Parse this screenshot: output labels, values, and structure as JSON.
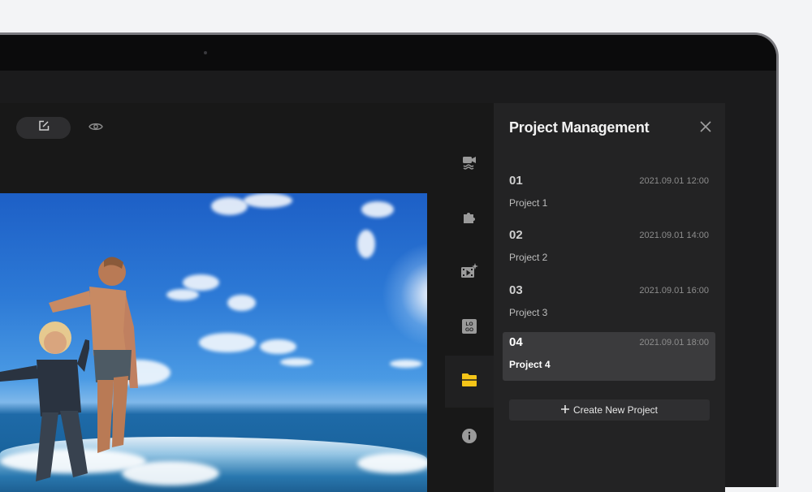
{
  "toolbar": {
    "edit_icon": "edit-square-icon",
    "preview_icon": "eye-icon"
  },
  "sidebar": {
    "items": [
      {
        "icon": "video-camera-icon",
        "active": false
      },
      {
        "icon": "puzzle-icon",
        "active": false
      },
      {
        "icon": "sparkle-video-icon",
        "active": false
      },
      {
        "icon": "logo-icon",
        "active": false
      },
      {
        "icon": "folder-icon",
        "active": true
      },
      {
        "icon": "info-icon",
        "active": false
      }
    ],
    "accent_color": "#f5c518"
  },
  "panel": {
    "title": "Project Management",
    "projects": [
      {
        "number": "01",
        "date": "2021.09.01 12:00",
        "name": "Project 1",
        "active": false
      },
      {
        "number": "02",
        "date": "2021.09.01 14:00",
        "name": "Project 2",
        "active": false
      },
      {
        "number": "03",
        "date": "2021.09.01 16:00",
        "name": "Project 3",
        "active": false
      },
      {
        "number": "04",
        "date": "2021.09.01 18:00",
        "name": "Project 4",
        "active": true
      }
    ],
    "create_label": "Create New Project",
    "create_icon": "plus-icon"
  }
}
